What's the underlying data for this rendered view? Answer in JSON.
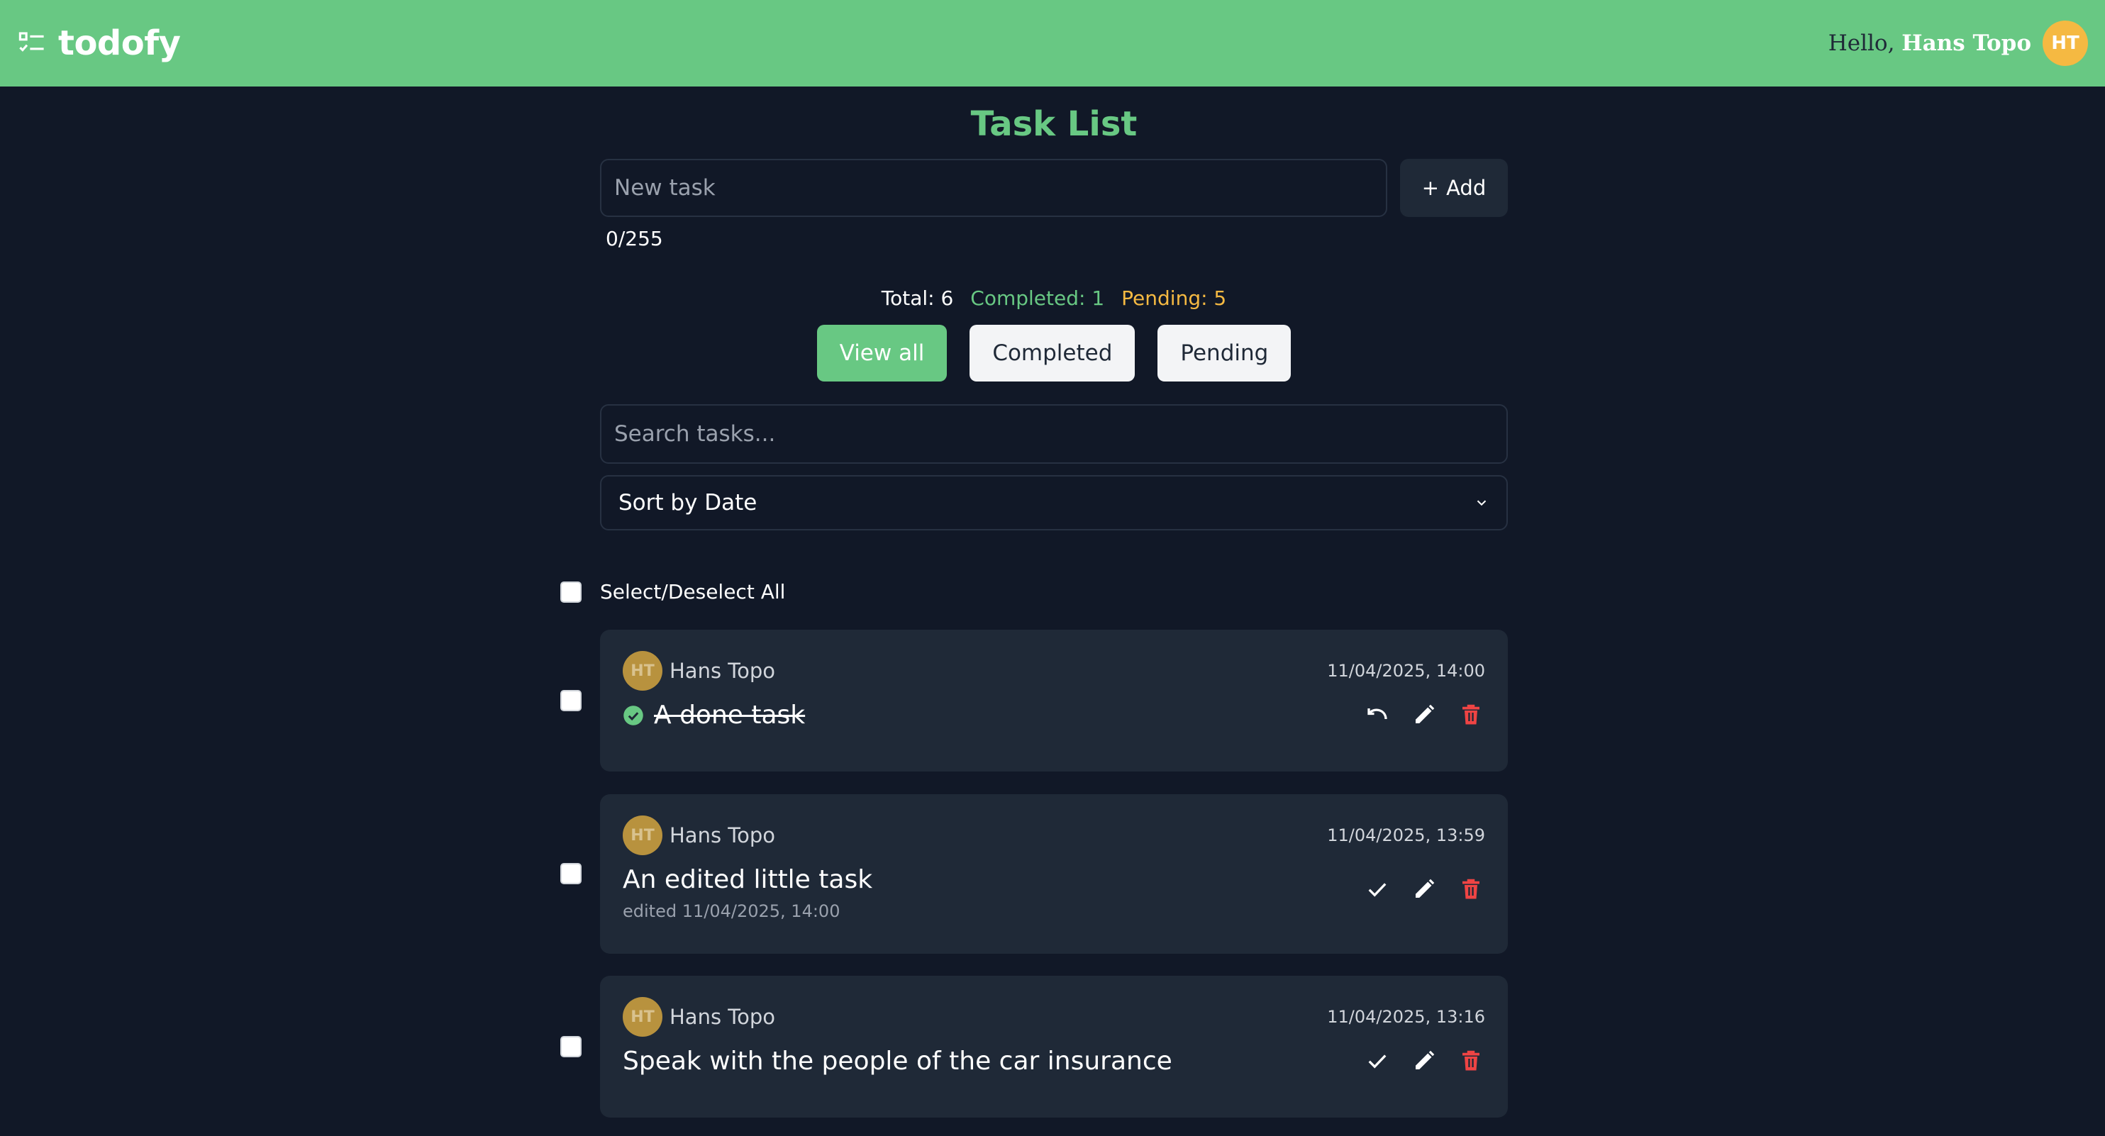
{
  "app": {
    "name": "todofy"
  },
  "header": {
    "greeting": "Hello,",
    "user_name": "Hans Topo",
    "user_initials": "HT"
  },
  "main": {
    "title": "Task List",
    "new_task": {
      "placeholder": "New task",
      "value": "",
      "counter": "0/255"
    },
    "add_button": {
      "icon": "+",
      "label": "Add"
    },
    "stats": {
      "total": "Total: 6",
      "completed": "Completed: 1",
      "pending": "Pending: 5"
    },
    "filters": [
      {
        "label": "View all",
        "active": true
      },
      {
        "label": "Completed",
        "active": false
      },
      {
        "label": "Pending",
        "active": false
      }
    ],
    "search": {
      "placeholder": "Search tasks..."
    },
    "sort": {
      "selected": "Sort by Date"
    },
    "select_all_label": "Select/Deselect All"
  },
  "tasks": [
    {
      "author": "Hans Topo",
      "initials": "HT",
      "date": "11/04/2025, 14:00",
      "text": "A done task",
      "done": true,
      "edited": "",
      "status_icon": "check-circle-icon",
      "primary_action_icon": "undo-icon"
    },
    {
      "author": "Hans Topo",
      "initials": "HT",
      "date": "11/04/2025, 13:59",
      "text": "An edited little task",
      "done": false,
      "edited": "edited 11/04/2025, 14:00",
      "primary_action_icon": "check-icon"
    },
    {
      "author": "Hans Topo",
      "initials": "HT",
      "date": "11/04/2025, 13:16",
      "text": "Speak with the people of the car insurance",
      "done": false,
      "edited": "",
      "primary_action_icon": "check-icon"
    }
  ],
  "colors": {
    "brand_green": "#68c883",
    "background": "#111827",
    "card": "#1f2937",
    "pending_amber": "#f5b942",
    "delete_red": "#ef4444"
  }
}
